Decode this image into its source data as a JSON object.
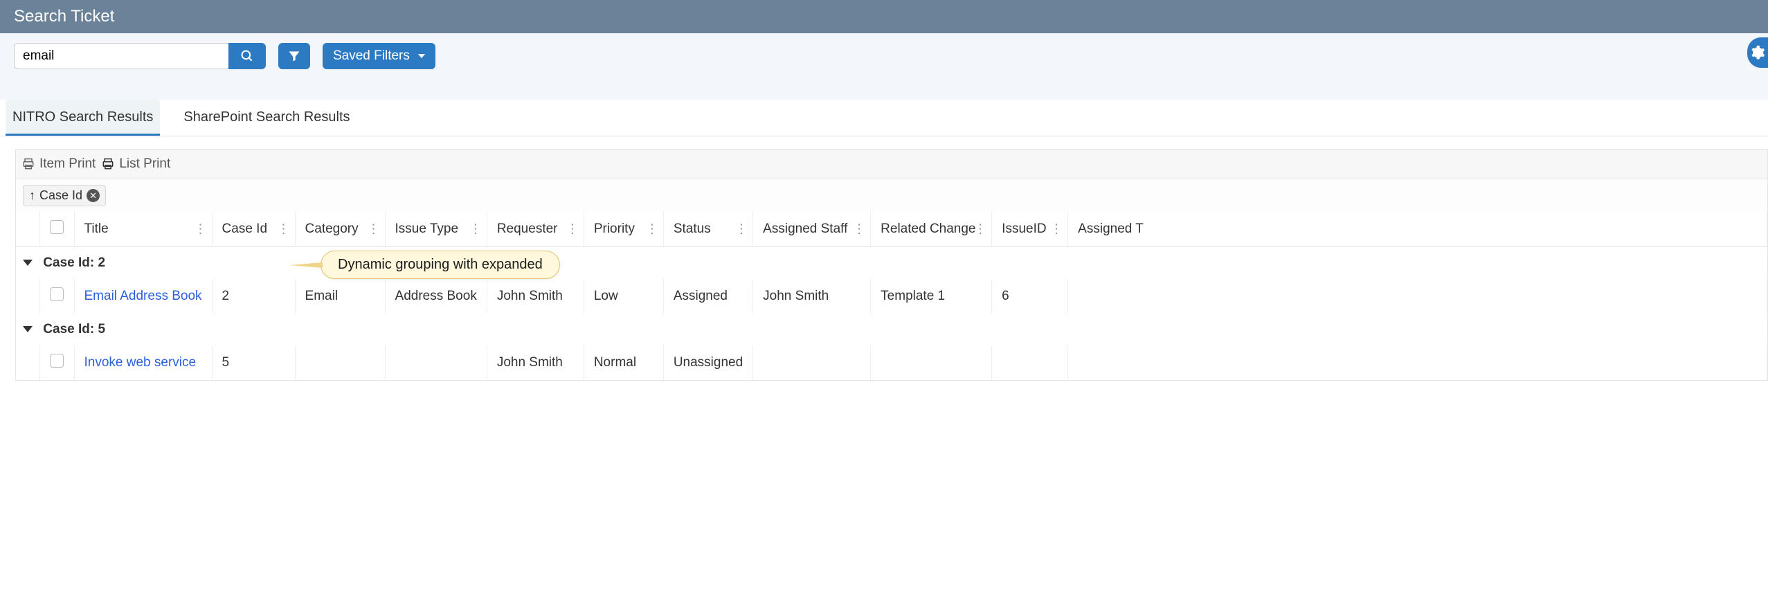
{
  "header": {
    "title": "Search Ticket"
  },
  "toolbar": {
    "search_value": "email",
    "saved_filters_label": "Saved Filters"
  },
  "tabs": [
    {
      "label": "NITRO Search Results",
      "active": true
    },
    {
      "label": "SharePoint Search Results",
      "active": false
    }
  ],
  "actions": {
    "item_print": "Item Print",
    "list_print": "List Print"
  },
  "group_tag": {
    "sort_dir": "asc",
    "field_label": "Case Id"
  },
  "columns": [
    "Title",
    "Case Id",
    "Category",
    "Issue Type",
    "Requester",
    "Priority",
    "Status",
    "Assigned Staff",
    "Related Change",
    "IssueID",
    "Assigned T"
  ],
  "groups": [
    {
      "header": "Case Id: 2",
      "rows": [
        {
          "title": "Email Address Book",
          "case_id": "2",
          "category": "Email",
          "issue_type": "Address Book",
          "requester": "John Smith",
          "priority": "Low",
          "status": "Assigned",
          "assigned_staff": "John Smith",
          "related_change": "Template 1",
          "issue_id": "6",
          "assigned_t": ""
        }
      ]
    },
    {
      "header": "Case Id: 5",
      "rows": [
        {
          "title": "Invoke web service",
          "case_id": "5",
          "category": "",
          "issue_type": "",
          "requester": "John Smith",
          "priority": "Normal",
          "status": "Unassigned",
          "assigned_staff": "",
          "related_change": "",
          "issue_id": "",
          "assigned_t": ""
        }
      ]
    }
  ],
  "callout": {
    "text": "Dynamic grouping with expanded"
  }
}
